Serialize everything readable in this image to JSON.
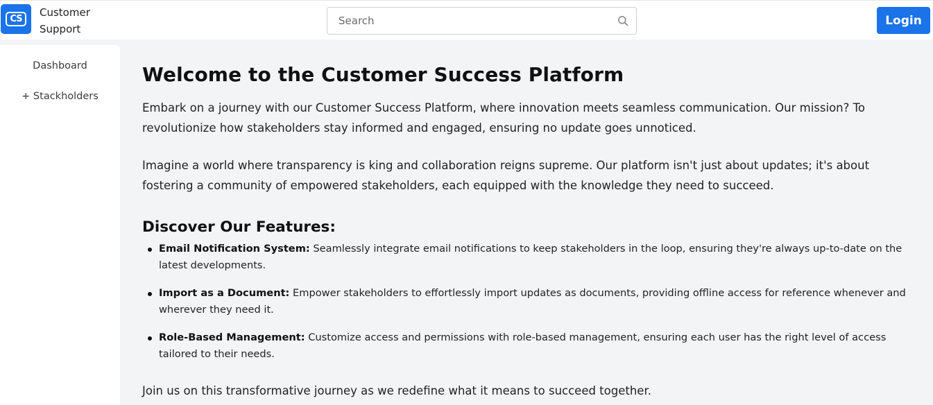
{
  "header": {
    "logo_text": "CS",
    "brand_line1": "Customer",
    "brand_line2": "Support",
    "search_placeholder": "Search",
    "login_label": "Login"
  },
  "sidebar": {
    "items": [
      {
        "label": "Dashboard"
      },
      {
        "label": "+ Stackholders"
      }
    ]
  },
  "main": {
    "title": "Welcome to the Customer Success Platform",
    "intro": "Embark on a journey with our Customer Success Platform, where innovation meets seamless communication. Our mission? To revolutionize how stakeholders stay informed and engaged, ensuring no update goes unnoticed.",
    "vision": "Imagine a world where transparency is king and collaboration reigns supreme. Our platform isn't just about updates; it's about fostering a community of empowered stakeholders, each equipped with the knowledge they need to succeed.",
    "features_title": "Discover Our Features:",
    "features": [
      {
        "name": "Email Notification System:",
        "text": " Seamlessly integrate email notifications to keep stakeholders in the loop, ensuring they're always up-to-date on the latest developments."
      },
      {
        "name": "Import as a Document:",
        "text": " Empower stakeholders to effortlessly import updates as documents, providing offline access for reference whenever and wherever they need it."
      },
      {
        "name": "Role-Based Management:",
        "text": " Customize access and permissions with role-based management, ensuring each user has the right level of access tailored to their needs."
      }
    ],
    "closing": "Join us on this transformative journey as we redefine what it means to succeed together."
  },
  "colors": {
    "accent": "#1a73e8",
    "page_background": "#f3f4f6",
    "panel_background": "#ffffff"
  },
  "icons": {
    "search": "search-icon",
    "logo": "cs-logo-icon"
  }
}
